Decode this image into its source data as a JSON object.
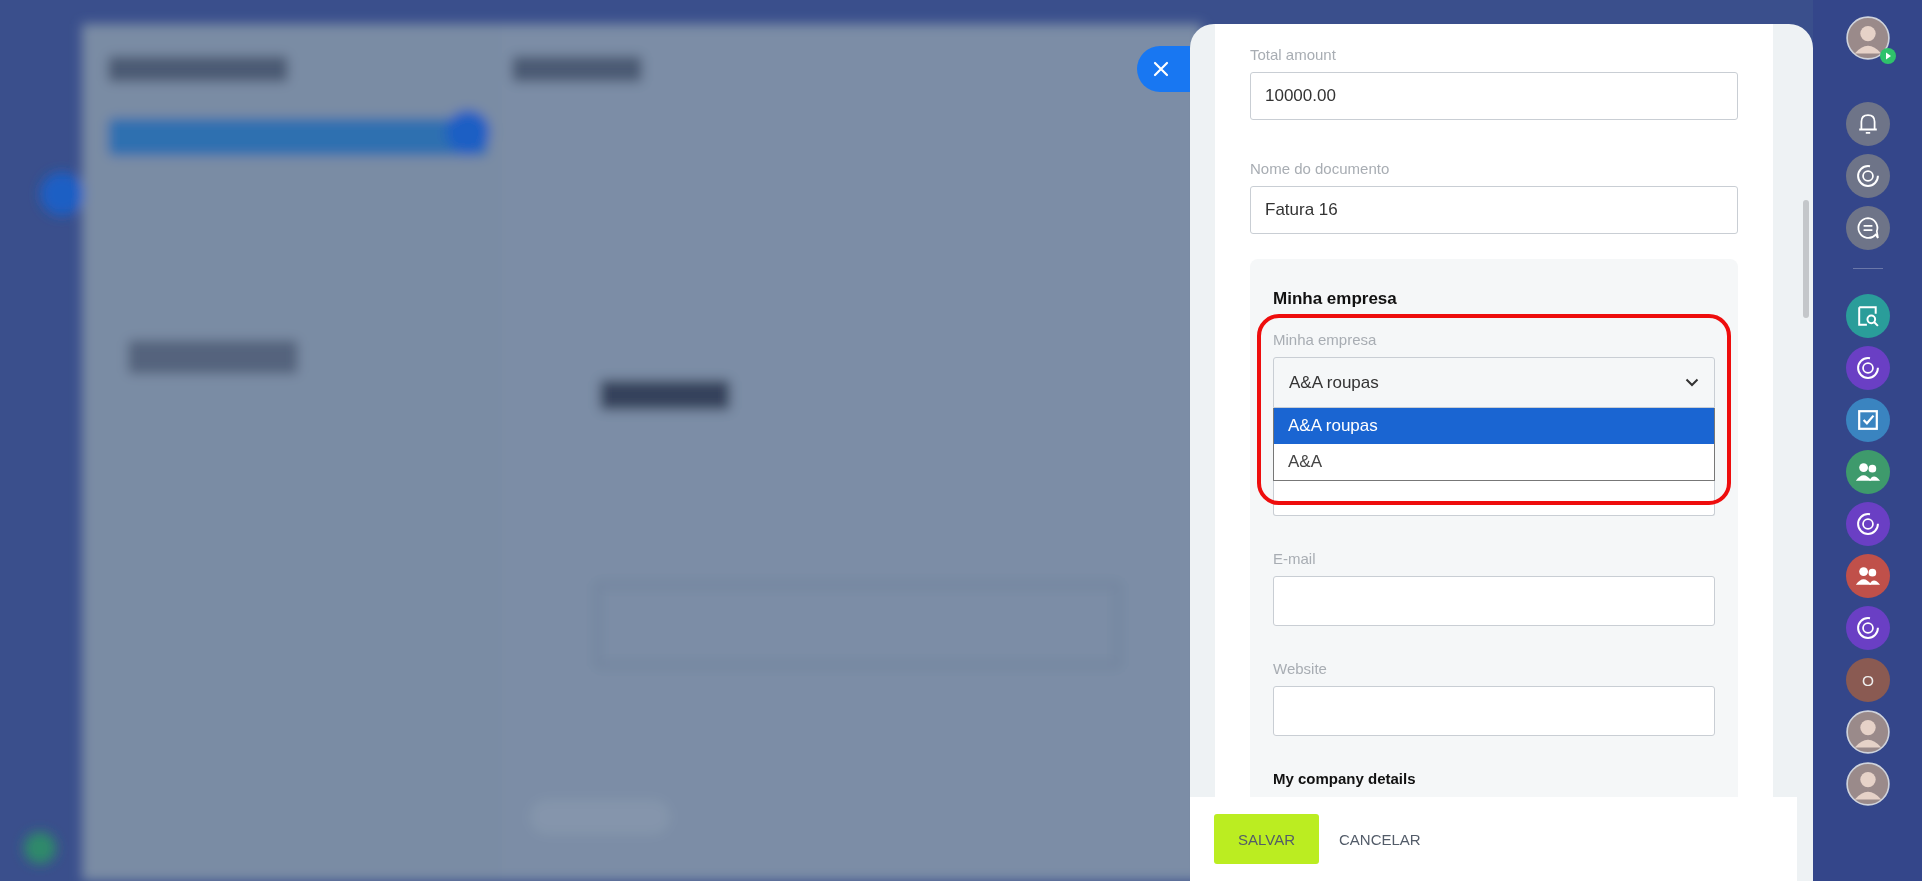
{
  "panel": {
    "fields": [
      {
        "label": "Total amount",
        "value": "10000.00"
      },
      {
        "label": "Nome do documento",
        "value": "Fatura 16"
      }
    ],
    "section": {
      "title": "Minha empresa",
      "highlighted": true,
      "select": {
        "label": "Minha empresa",
        "value": "A&A roupas",
        "expanded": true,
        "options": [
          {
            "label": "A&A roupas",
            "selected": true
          },
          {
            "label": "A&A",
            "selected": false
          }
        ]
      },
      "fields": [
        {
          "label": "E-mail"
        },
        {
          "label": "Website"
        }
      ],
      "subtitle": "My company details"
    },
    "buttons": [
      {
        "label": "SALVAR",
        "kind": "primary"
      },
      {
        "label": "CANCELAR",
        "kind": "link"
      }
    ]
  },
  "right_bar": [
    {
      "kind": "avatar",
      "online": true
    },
    {
      "kind": "bell"
    },
    {
      "kind": "spiral"
    },
    {
      "kind": "chat"
    },
    {
      "kind": "divider"
    },
    {
      "kind": "search-doc",
      "color": "#2a9d9a"
    },
    {
      "kind": "spiral",
      "color": "#6a3fc4"
    },
    {
      "kind": "task",
      "color": "#3a84c0"
    },
    {
      "kind": "people",
      "color": "#3e9a6c"
    },
    {
      "kind": "spiral",
      "color": "#6a3fc4"
    },
    {
      "kind": "people",
      "color": "#c0504a"
    },
    {
      "kind": "spiral",
      "color": "#6a3fc4"
    },
    {
      "kind": "letter",
      "color": "#8a5a52",
      "text": "O"
    },
    {
      "kind": "avatar"
    },
    {
      "kind": "avatar"
    }
  ]
}
